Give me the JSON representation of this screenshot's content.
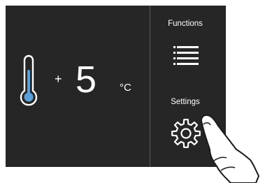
{
  "display": {
    "sign": "+",
    "temperature_value": "5",
    "unit": "°C",
    "thermometer_icon": "thermometer-icon"
  },
  "menu": {
    "functions_label": "Functions",
    "functions_icon": "list-icon",
    "settings_label": "Settings",
    "settings_icon": "gear-icon"
  },
  "colors": {
    "panel_background": "#262626",
    "text": "#ffffff",
    "thermometer_accent": "#5aa0d8"
  }
}
